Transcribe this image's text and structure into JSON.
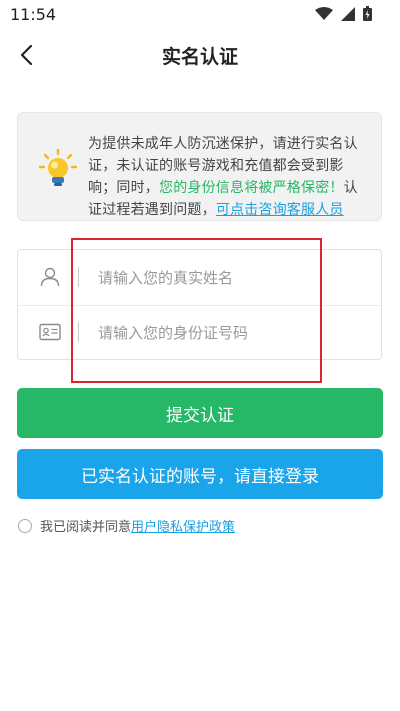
{
  "status": {
    "time": "11:54"
  },
  "nav": {
    "title": "实名认证"
  },
  "notice": {
    "text_plain": "为提供未成年人防沉迷保护，请进行实名认证，未认证的账号游戏和充值都会受到影响；同时，",
    "text_green": "您的身份信息将被严格保密！",
    "text_after": "认证过程若遇到问题，",
    "link_text": "可点击咨询客服人员"
  },
  "form": {
    "name_placeholder": "请输入您的真实姓名",
    "id_placeholder": "请输入您的身份证号码",
    "name_value": "",
    "id_value": ""
  },
  "buttons": {
    "submit_label": "提交认证",
    "login_label": "已实名认证的账号，请直接登录"
  },
  "agreement": {
    "prefix": "我已阅读并同意",
    "link_text": "用户隐私保护政策",
    "checked": false
  },
  "colors": {
    "green": "#26b767",
    "blue": "#1aa5ea",
    "highlight": "#d9262e"
  },
  "icons": [
    "back-arrow-icon",
    "lightbulb-icon",
    "person-icon",
    "id-card-icon",
    "wifi-icon",
    "signal-icon",
    "battery-icon"
  ]
}
